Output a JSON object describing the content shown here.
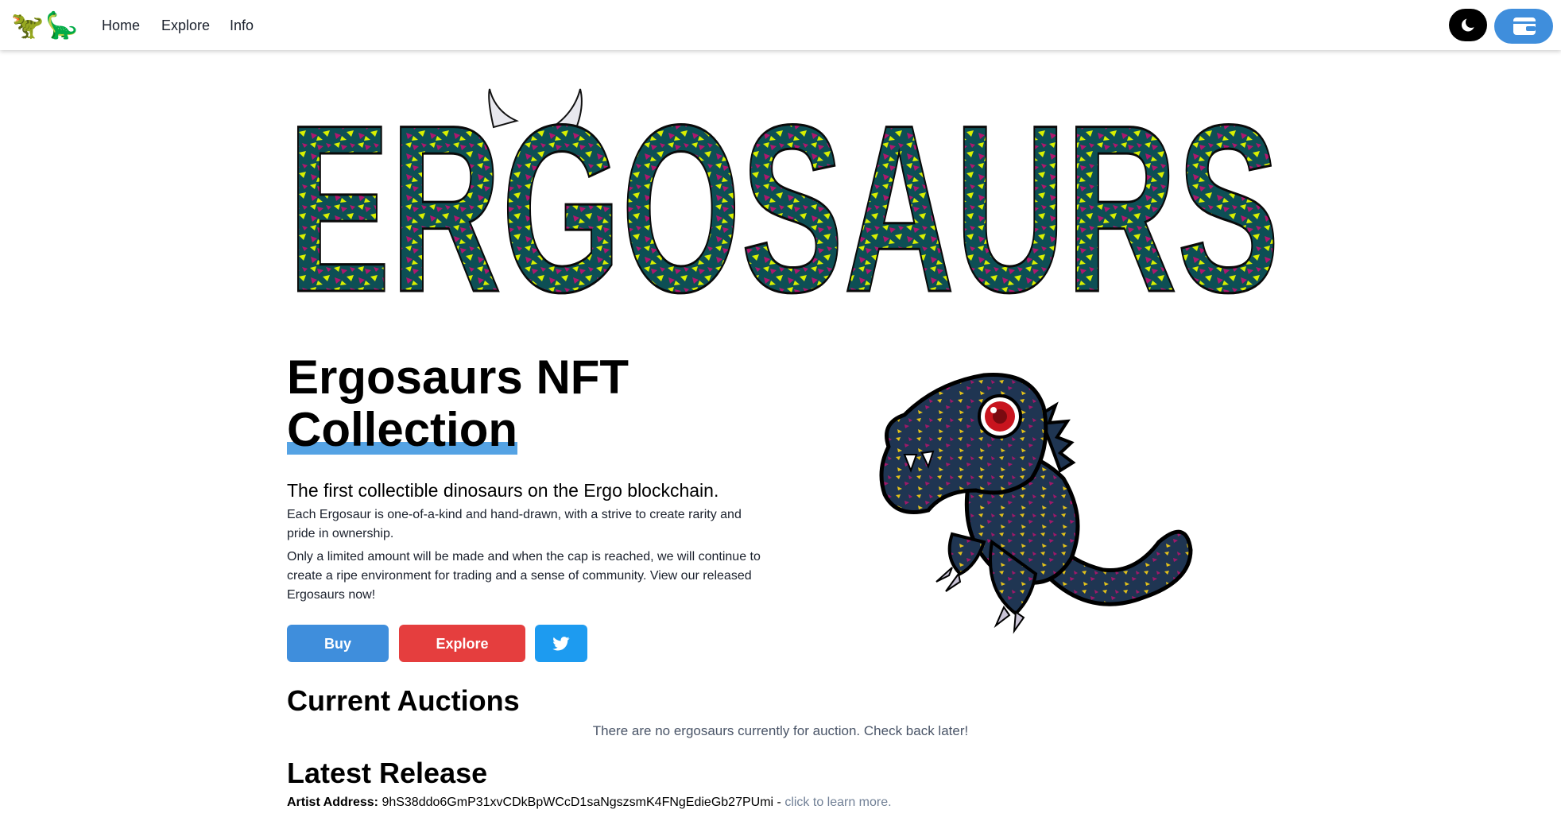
{
  "nav": {
    "brand_icons": [
      "🦖",
      "🦕"
    ],
    "links": [
      "Home",
      "Explore",
      "Info"
    ],
    "theme_icon": "moon-icon",
    "wallet_icon": "wallet-icon"
  },
  "hero": {
    "logo_text": "ERGOSAURS",
    "title_line1": "Ergosaurs NFT",
    "title_line2": "Collection",
    "tagline": "The first collectible dinosaurs on the Ergo blockchain.",
    "paragraph1": "Each Ergosaur is one-of-a-kind and hand-drawn, with a strive to create rarity and pride in ownership.",
    "paragraph2": "Only a limited amount will be made and when the cap is reached, we will continue to create a ripe environment for trading and a sense of community. View our released Ergosaurs now!",
    "buttons": {
      "buy": "Buy",
      "explore": "Explore",
      "twitter_icon": "twitter-icon"
    }
  },
  "auctions": {
    "title": "Current Auctions",
    "empty_message": "There are no ergosaurs currently for auction. Check back later!"
  },
  "latest": {
    "title": "Latest Release",
    "artist_label": "Artist Address:",
    "artist_address": "9hS38ddo6GmP31xvCDkBpWCcD1saNgszsmK4FNgEdieGb27PUmi",
    "separator": "-",
    "learn_more": "click to learn more."
  },
  "colors": {
    "primary": "#3f8edc",
    "danger": "#e53e3e",
    "twitter": "#1d9bf0",
    "logo_teal": "#0d4f55",
    "logo_magenta": "#b0166e",
    "logo_yellow": "#d8f000"
  }
}
